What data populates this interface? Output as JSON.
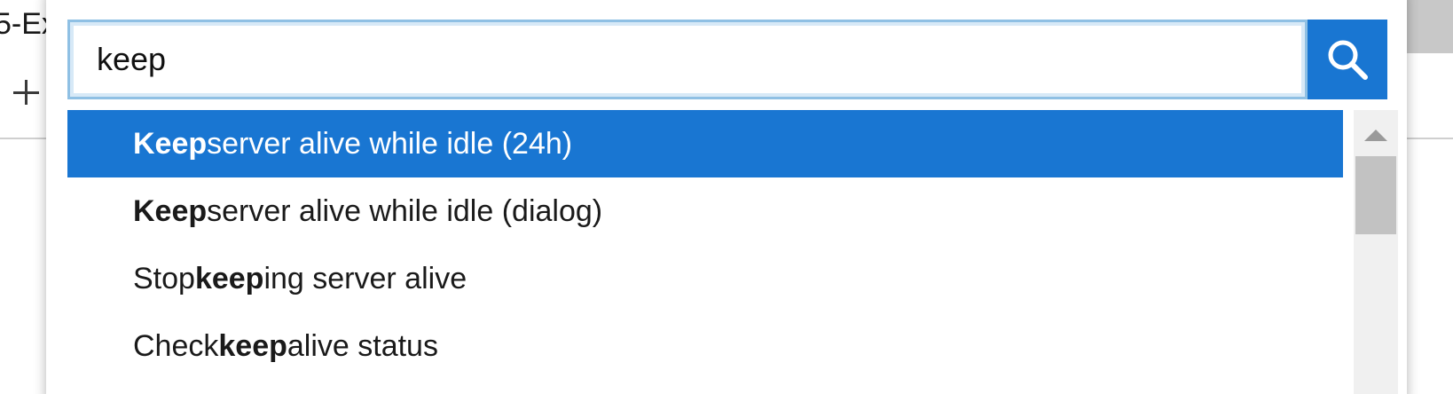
{
  "background": {
    "title_fragment": "5-Ex",
    "new_tab_icon": "plus-icon"
  },
  "palette": {
    "search": {
      "value": "keep",
      "button_icon": "search-icon"
    },
    "results": [
      {
        "pre": "",
        "match": "Keep",
        "post": " server alive while idle (24h)",
        "selected": true
      },
      {
        "pre": "",
        "match": "Keep",
        "post": " server alive while idle (dialog)",
        "selected": false
      },
      {
        "pre": "Stop ",
        "match": "keep",
        "post": "ing server alive",
        "selected": false
      },
      {
        "pre": "Check ",
        "match": "keep",
        "post": "alive status",
        "selected": false
      }
    ],
    "scrollbar": {
      "up_icon": "scroll-up-arrow-icon"
    }
  },
  "colors": {
    "accent": "#1976d2",
    "input_border": "#8fc0e4",
    "selected_text": "#ffffff"
  }
}
